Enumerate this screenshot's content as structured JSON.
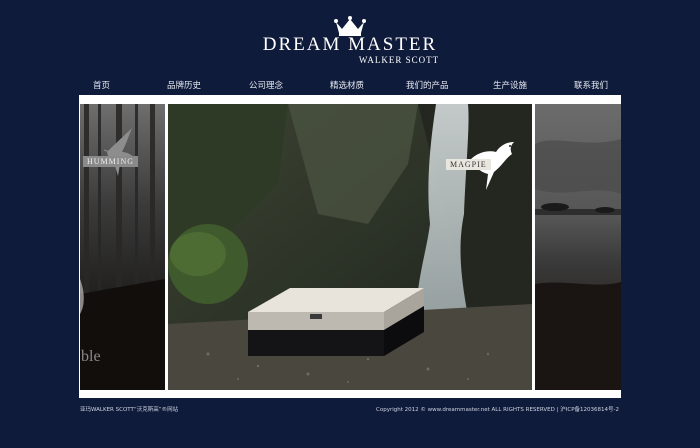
{
  "brand": {
    "name": "DREAM MASTER",
    "sub": "WALKER SCOTT"
  },
  "nav": [
    {
      "label": "首页"
    },
    {
      "label": "品牌历史"
    },
    {
      "label": "公司理念"
    },
    {
      "label": "精选材质"
    },
    {
      "label": "我们的产品"
    },
    {
      "label": "生产设施"
    },
    {
      "label": "联系我们"
    }
  ],
  "slides": {
    "left": {
      "label": "HUMMING",
      "partial_text": "ble"
    },
    "center": {
      "label": "MAGPIE"
    }
  },
  "footer": {
    "left": "亚玛WALKER SCOTT“沃克斯高”®网站",
    "right": "Copyright 2012 © www.dreammaster.net ALL RIGHTS RESERVED | 沪ICP备12036814号-2"
  },
  "icons": [
    "crown-icon",
    "hummingbird-icon",
    "magpie-icon",
    "mattress-image",
    "waterfall-image"
  ],
  "colors": {
    "background": "#0f1b3a",
    "panel_frame": "#ffffff",
    "label_bg": "#e9e6df"
  }
}
